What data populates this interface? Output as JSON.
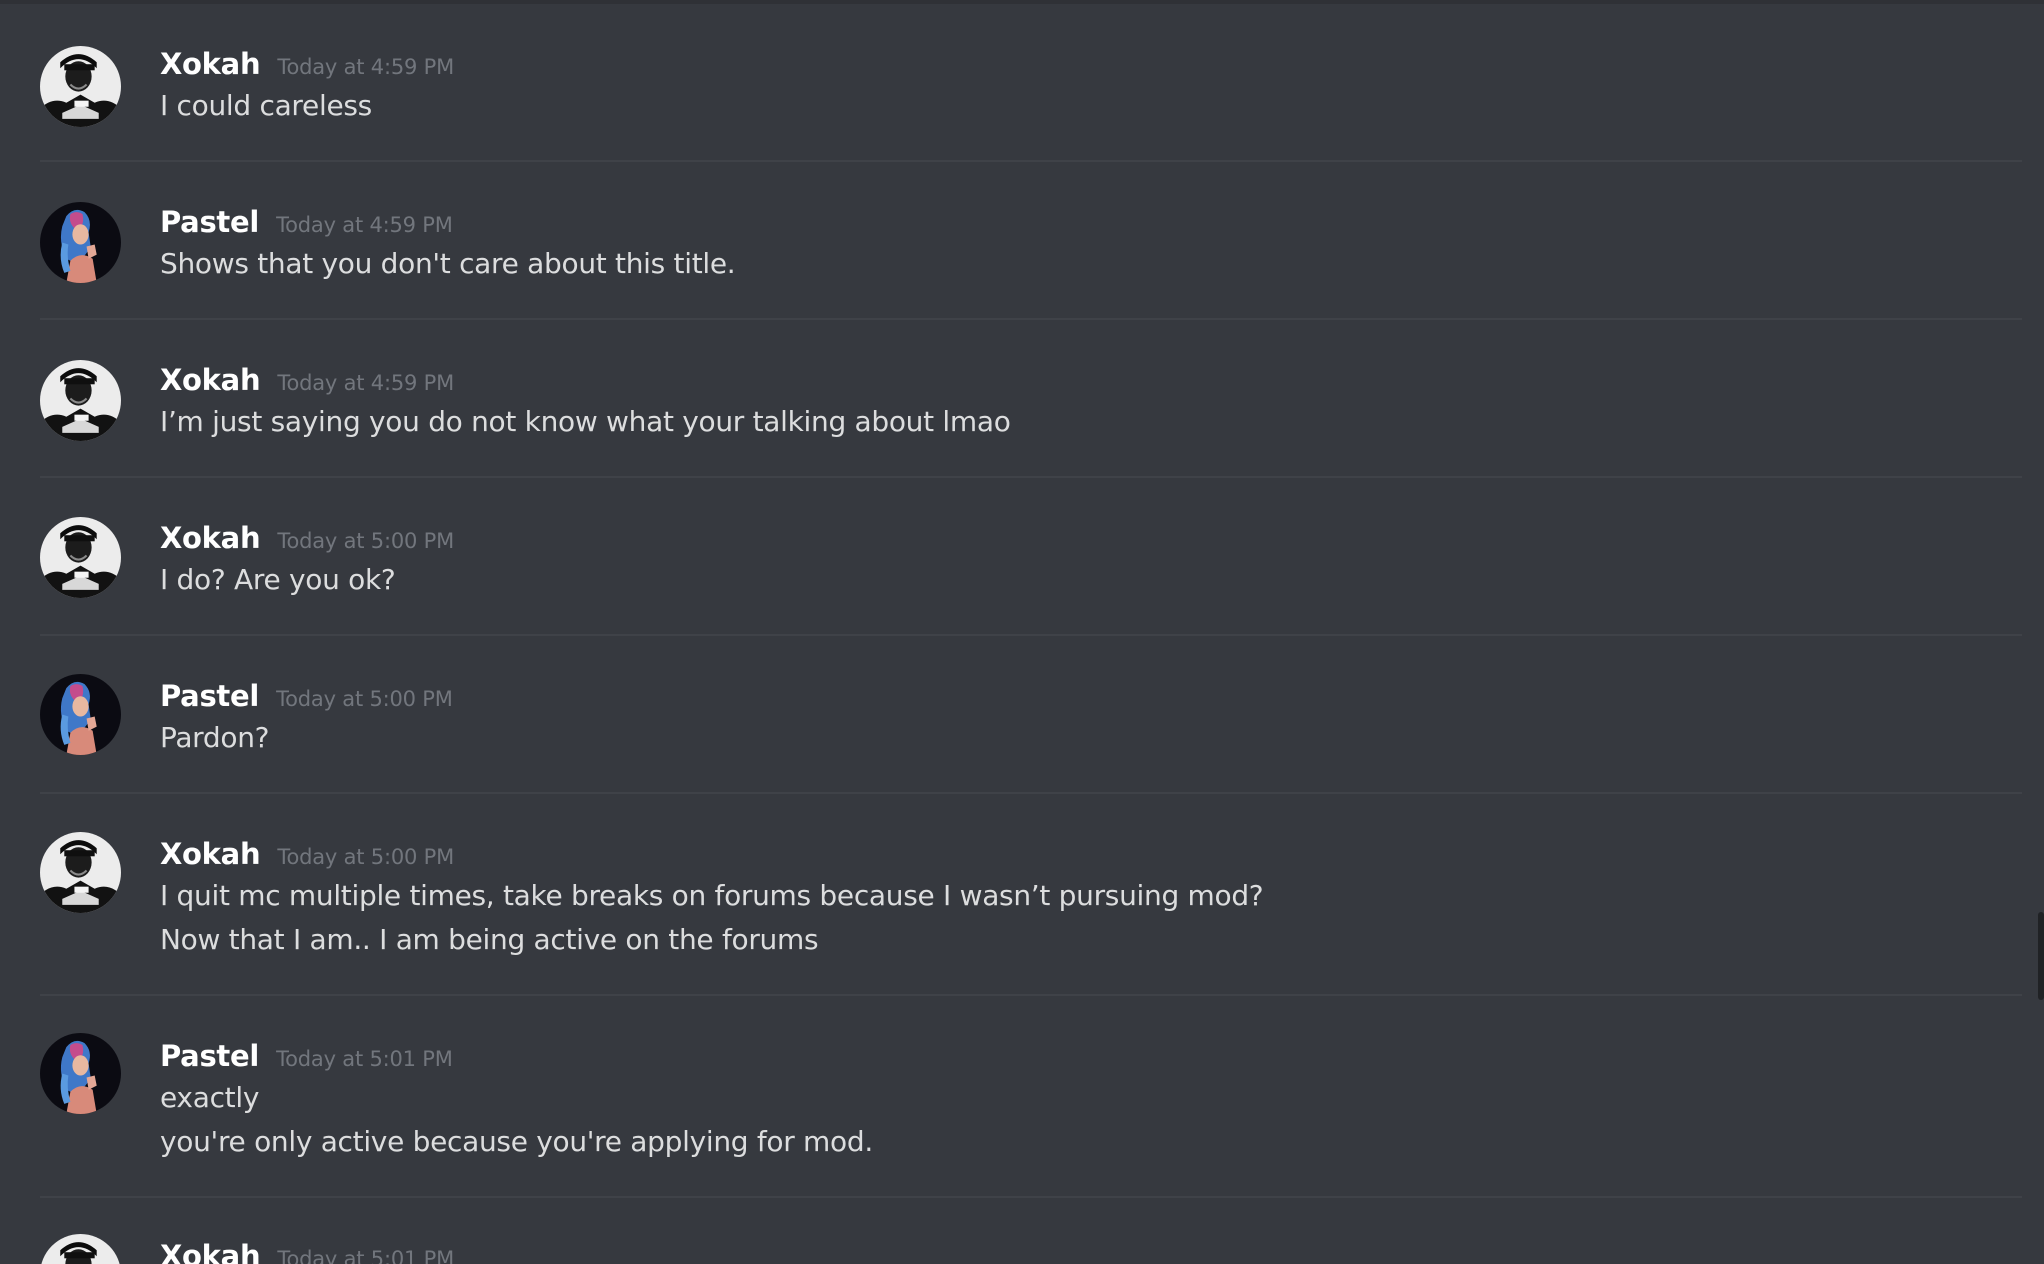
{
  "messages": [
    {
      "username": "Xokah",
      "avatar": "xokah-avatar-icon",
      "timestamp": "Today at 4:59 PM",
      "lines": [
        "I could careless"
      ]
    },
    {
      "username": "Pastel",
      "avatar": "pastel-avatar-icon",
      "timestamp": "Today at 4:59 PM",
      "lines": [
        "Shows that you don't care about this title."
      ]
    },
    {
      "username": "Xokah",
      "avatar": "xokah-avatar-icon",
      "timestamp": "Today at 4:59 PM",
      "lines": [
        "I’m just saying you do not know what your talking about lmao"
      ]
    },
    {
      "username": "Xokah",
      "avatar": "xokah-avatar-icon",
      "timestamp": "Today at 5:00 PM",
      "lines": [
        "I do? Are you ok?"
      ]
    },
    {
      "username": "Pastel",
      "avatar": "pastel-avatar-icon",
      "timestamp": "Today at 5:00 PM",
      "lines": [
        "Pardon?"
      ]
    },
    {
      "username": "Xokah",
      "avatar": "xokah-avatar-icon",
      "timestamp": "Today at 5:00 PM",
      "lines": [
        "I quit mc multiple times, take breaks on forums because I wasn’t pursuing mod?",
        "Now that I am.. I am being active on the forums"
      ]
    },
    {
      "username": "Pastel",
      "avatar": "pastel-avatar-icon",
      "timestamp": "Today at 5:01 PM",
      "lines": [
        "exactly",
        "you're only active because you're applying for mod."
      ]
    },
    {
      "username": "Xokah",
      "avatar": "xokah-avatar-icon",
      "timestamp": "Today at 5:01 PM",
      "lines": []
    }
  ],
  "colors": {
    "background": "#36393f",
    "username": "#ffffff",
    "timestamp": "#72767d",
    "message_text": "#dcddde",
    "divider": "#3f4248"
  }
}
